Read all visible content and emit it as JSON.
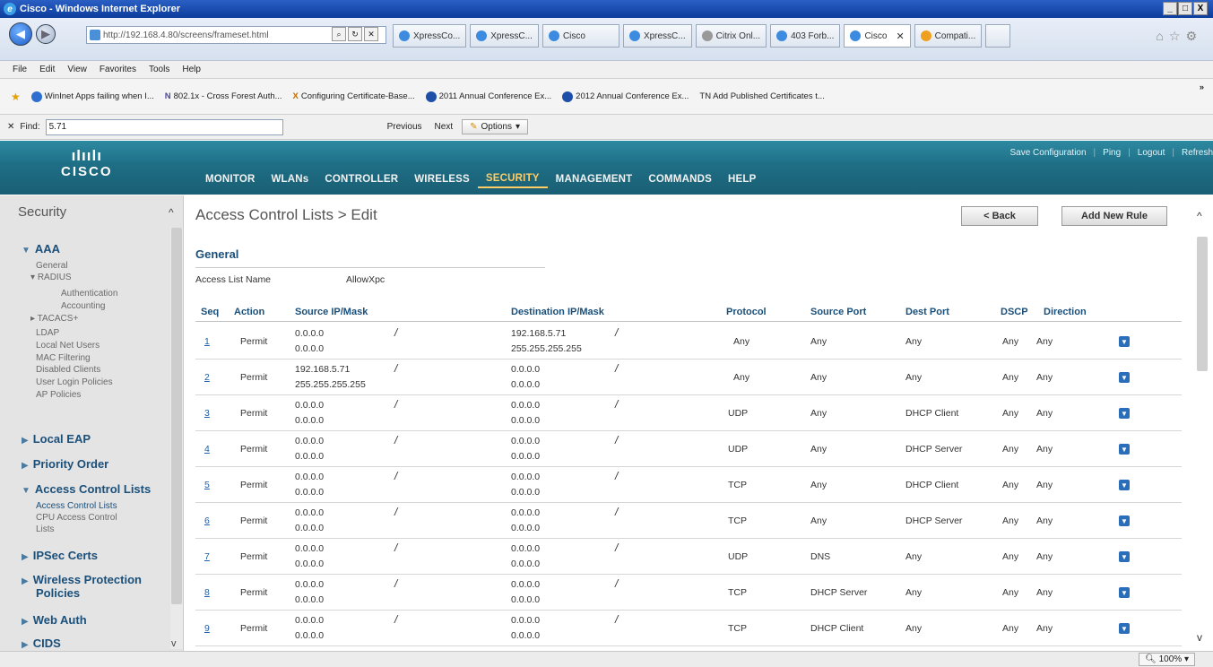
{
  "window": {
    "title": "Cisco - Windows Internet Explorer",
    "controls": [
      "_",
      "□",
      "X"
    ]
  },
  "browser": {
    "address": "http://192.168.4.80/screens/frameset.html",
    "tabs": [
      {
        "label": "XpressCo...",
        "active": false
      },
      {
        "label": "XpressC...",
        "active": false
      },
      {
        "label": "Cisco",
        "active": false
      },
      {
        "label": "XpressC...",
        "active": false
      },
      {
        "label": "Citrix Onl...",
        "active": false
      },
      {
        "label": "403 Forb...",
        "active": false
      },
      {
        "label": "Cisco",
        "active": true
      },
      {
        "label": "Compati...",
        "active": false
      }
    ],
    "menu": [
      "File",
      "Edit",
      "View",
      "Favorites",
      "Tools",
      "Help"
    ],
    "favorites": [
      "WinInet Apps failing when I...",
      "802.1x - Cross Forest Auth...",
      "Configuring Certificate-Base...",
      "2011 Annual Conference Ex...",
      "2012 Annual Conference Ex...",
      "TN Add Published Certificates t..."
    ],
    "find": {
      "label": "Find:",
      "value": "5.71",
      "previous": "Previous",
      "next": "Next",
      "options": "Options"
    },
    "zoom": "100%"
  },
  "wlc": {
    "logo_bars": "ılıılı",
    "logo_word": "CISCO",
    "top_links": [
      "Save Configuration",
      "Ping",
      "Logout",
      "Refresh"
    ],
    "nav": [
      {
        "label": "MONITOR",
        "active": false
      },
      {
        "label": "WLANs",
        "active": false
      },
      {
        "label": "CONTROLLER",
        "active": false
      },
      {
        "label": "WIRELESS",
        "active": false
      },
      {
        "label": "SECURITY",
        "active": true
      },
      {
        "label": "MANAGEMENT",
        "active": false
      },
      {
        "label": "COMMANDS",
        "active": false
      },
      {
        "label": "HELP",
        "active": false
      }
    ]
  },
  "sidebar": {
    "title": "Security",
    "aaa": "AAA",
    "general": "General",
    "radius": "RADIUS",
    "authentication": "Authentication",
    "accounting": "Accounting",
    "tacacs": "TACACS+",
    "ldap": "LDAP",
    "local_net_users": "Local Net Users",
    "mac_filtering": "MAC Filtering",
    "disabled_clients": "Disabled Clients",
    "user_login_policies": "User Login Policies",
    "ap_policies": "AP Policies",
    "local_eap": "Local EAP",
    "priority_order": "Priority Order",
    "acl": "Access Control Lists",
    "acl_sub": "Access Control Lists",
    "cpu_acl_1": "CPU Access Control",
    "cpu_acl_2": "Lists",
    "ipsec": "IPSec Certs",
    "wpp_1": "Wireless Protection",
    "wpp_2": "Policies",
    "web_auth": "Web Auth",
    "cids": "CIDS"
  },
  "page": {
    "title": "Access Control Lists > Edit",
    "back_button": "< Back",
    "add_rule_button": "Add New Rule",
    "section": "General",
    "acl_name_label": "Access List Name",
    "acl_name_value": "AllowXpc"
  },
  "table": {
    "headers": {
      "seq": "Seq",
      "action": "Action",
      "source": "Source IP/Mask",
      "dest": "Destination IP/Mask",
      "protocol": "Protocol",
      "source_port": "Source Port",
      "dest_port": "Dest Port",
      "dscp": "DSCP",
      "direction": "Direction"
    },
    "rows": [
      {
        "seq": "1",
        "action": "Permit",
        "src_ip": "0.0.0.0",
        "src_mask": "0.0.0.0",
        "dst_ip": "192.168.5.71",
        "dst_mask": "255.255.255.255",
        "protocol": "Any",
        "source_port": "Any",
        "dest_port": "Any",
        "dscp": "Any",
        "direction": "Any"
      },
      {
        "seq": "2",
        "action": "Permit",
        "src_ip": "192.168.5.71",
        "src_mask": "255.255.255.255",
        "dst_ip": "0.0.0.0",
        "dst_mask": "0.0.0.0",
        "protocol": "Any",
        "source_port": "Any",
        "dest_port": "Any",
        "dscp": "Any",
        "direction": "Any"
      },
      {
        "seq": "3",
        "action": "Permit",
        "src_ip": "0.0.0.0",
        "src_mask": "0.0.0.0",
        "dst_ip": "0.0.0.0",
        "dst_mask": "0.0.0.0",
        "protocol": "UDP",
        "source_port": "Any",
        "dest_port": "DHCP Client",
        "dscp": "Any",
        "direction": "Any"
      },
      {
        "seq": "4",
        "action": "Permit",
        "src_ip": "0.0.0.0",
        "src_mask": "0.0.0.0",
        "dst_ip": "0.0.0.0",
        "dst_mask": "0.0.0.0",
        "protocol": "UDP",
        "source_port": "Any",
        "dest_port": "DHCP Server",
        "dscp": "Any",
        "direction": "Any"
      },
      {
        "seq": "5",
        "action": "Permit",
        "src_ip": "0.0.0.0",
        "src_mask": "0.0.0.0",
        "dst_ip": "0.0.0.0",
        "dst_mask": "0.0.0.0",
        "protocol": "TCP",
        "source_port": "Any",
        "dest_port": "DHCP Client",
        "dscp": "Any",
        "direction": "Any"
      },
      {
        "seq": "6",
        "action": "Permit",
        "src_ip": "0.0.0.0",
        "src_mask": "0.0.0.0",
        "dst_ip": "0.0.0.0",
        "dst_mask": "0.0.0.0",
        "protocol": "TCP",
        "source_port": "Any",
        "dest_port": "DHCP Server",
        "dscp": "Any",
        "direction": "Any"
      },
      {
        "seq": "7",
        "action": "Permit",
        "src_ip": "0.0.0.0",
        "src_mask": "0.0.0.0",
        "dst_ip": "0.0.0.0",
        "dst_mask": "0.0.0.0",
        "protocol": "UDP",
        "source_port": "DNS",
        "dest_port": "Any",
        "dscp": "Any",
        "direction": "Any"
      },
      {
        "seq": "8",
        "action": "Permit",
        "src_ip": "0.0.0.0",
        "src_mask": "0.0.0.0",
        "dst_ip": "0.0.0.0",
        "dst_mask": "0.0.0.0",
        "protocol": "TCP",
        "source_port": "DHCP Server",
        "dest_port": "Any",
        "dscp": "Any",
        "direction": "Any"
      },
      {
        "seq": "9",
        "action": "Permit",
        "src_ip": "0.0.0.0",
        "src_mask": "0.0.0.0",
        "dst_ip": "0.0.0.0",
        "dst_mask": "0.0.0.0",
        "protocol": "TCP",
        "source_port": "DHCP Client",
        "dest_port": "Any",
        "dscp": "Any",
        "direction": "Any"
      }
    ]
  }
}
